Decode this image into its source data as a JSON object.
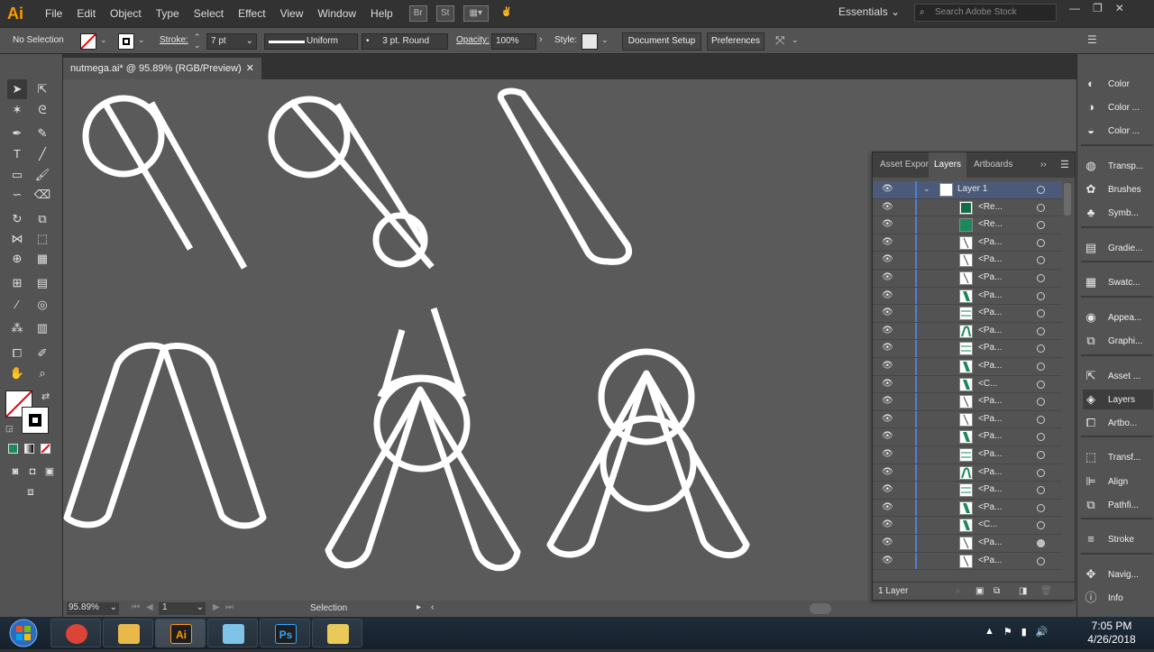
{
  "menubar": {
    "app_logo": "Ai",
    "items": [
      "File",
      "Edit",
      "Object",
      "Type",
      "Select",
      "Effect",
      "View",
      "Window",
      "Help"
    ],
    "bridge_icon": "Br",
    "stock_icon": "St",
    "workspace": "Essentials",
    "search_placeholder": "Search Adobe Stock",
    "window_controls": [
      "—",
      "❐",
      "✕"
    ]
  },
  "controlbar": {
    "selection_state": "No Selection",
    "stroke_label": "Stroke:",
    "stroke_value": "7 pt",
    "profile": "Uniform",
    "brush": "3 pt. Round",
    "opacity_label": "Opacity:",
    "opacity_value": "100%",
    "style_label": "Style:",
    "document_setup": "Document Setup",
    "preferences": "Preferences"
  },
  "document": {
    "tab_title": "nutmega.ai* @ 95.89% (RGB/Preview)",
    "close": "✕"
  },
  "statusbar": {
    "zoom": "95.89%",
    "artboard": "1",
    "tool": "Selection"
  },
  "dock": {
    "items": [
      {
        "label": "Color",
        "icon": "color-icon"
      },
      {
        "label": "Color ...",
        "icon": "color-guide-icon"
      },
      {
        "label": "Color ...",
        "icon": "color-themes-icon"
      },
      {
        "label": "Transp...",
        "icon": "transparency-icon"
      },
      {
        "label": "Brushes",
        "icon": "brushes-icon"
      },
      {
        "label": "Symb...",
        "icon": "symbols-icon"
      },
      {
        "label": "Gradie...",
        "icon": "gradient-icon"
      },
      {
        "label": "Swatc...",
        "icon": "swatches-icon"
      },
      {
        "label": "Appea...",
        "icon": "appearance-icon"
      },
      {
        "label": "Graphi...",
        "icon": "graphic-styles-icon"
      },
      {
        "label": "Asset ...",
        "icon": "asset-export-icon"
      },
      {
        "label": "Layers",
        "icon": "layers-icon"
      },
      {
        "label": "Artbo...",
        "icon": "artboards-icon"
      },
      {
        "label": "Transf...",
        "icon": "transform-icon"
      },
      {
        "label": "Align",
        "icon": "align-icon"
      },
      {
        "label": "Pathfi...",
        "icon": "pathfinder-icon"
      },
      {
        "label": "Stroke",
        "icon": "stroke-icon"
      },
      {
        "label": "Navig...",
        "icon": "navigator-icon"
      },
      {
        "label": "Info",
        "icon": "info-icon"
      }
    ]
  },
  "layers_panel": {
    "tabs": [
      "Asset Expor",
      "Layers",
      "Artboards"
    ],
    "active_tab": "Layers",
    "layer_name": "Layer 1",
    "rows": [
      {
        "name": "<Re...",
        "thumb": "green-rect"
      },
      {
        "name": "<Re...",
        "thumb": "green-fill"
      },
      {
        "name": "<Pa...",
        "thumb": "diag"
      },
      {
        "name": "<Pa...",
        "thumb": "diag"
      },
      {
        "name": "<Pa...",
        "thumb": "diag"
      },
      {
        "name": "<Pa...",
        "thumb": "green-diag"
      },
      {
        "name": "<Pa...",
        "thumb": "hlines"
      },
      {
        "name": "<Pa...",
        "thumb": "arch"
      },
      {
        "name": "<Pa...",
        "thumb": "hlines"
      },
      {
        "name": "<Pa...",
        "thumb": "green-diag"
      },
      {
        "name": "<C...",
        "thumb": "green-diag"
      },
      {
        "name": "<Pa...",
        "thumb": "diag"
      },
      {
        "name": "<Pa...",
        "thumb": "diag"
      },
      {
        "name": "<Pa...",
        "thumb": "green-diag"
      },
      {
        "name": "<Pa...",
        "thumb": "hlines"
      },
      {
        "name": "<Pa...",
        "thumb": "arch"
      },
      {
        "name": "<Pa...",
        "thumb": "hlines"
      },
      {
        "name": "<Pa...",
        "thumb": "green-diag"
      },
      {
        "name": "<C...",
        "thumb": "green-diag"
      },
      {
        "name": "<Pa...",
        "thumb": "diag"
      },
      {
        "name": "<Pa...",
        "thumb": "diag"
      }
    ],
    "footer": "1 Layer"
  },
  "taskbar": {
    "apps": [
      {
        "name": "chrome",
        "label": "",
        "color": "#db4437"
      },
      {
        "name": "explorer",
        "label": "",
        "color": "#e8b84a"
      },
      {
        "name": "illustrator",
        "label": "Ai",
        "color": "#ff9a00"
      },
      {
        "name": "notepad",
        "label": "",
        "color": "#7fc4e8"
      },
      {
        "name": "photoshop",
        "label": "Ps",
        "color": "#31a8ff"
      },
      {
        "name": "paint",
        "label": "",
        "color": "#e8c95a"
      }
    ],
    "time": "7:05 PM",
    "date": "4/26/2018"
  },
  "colors": {
    "accent_orange": "#ff9a00",
    "layer_blue": "#4f7fd6",
    "thumb_green": "#1a8a5a"
  }
}
